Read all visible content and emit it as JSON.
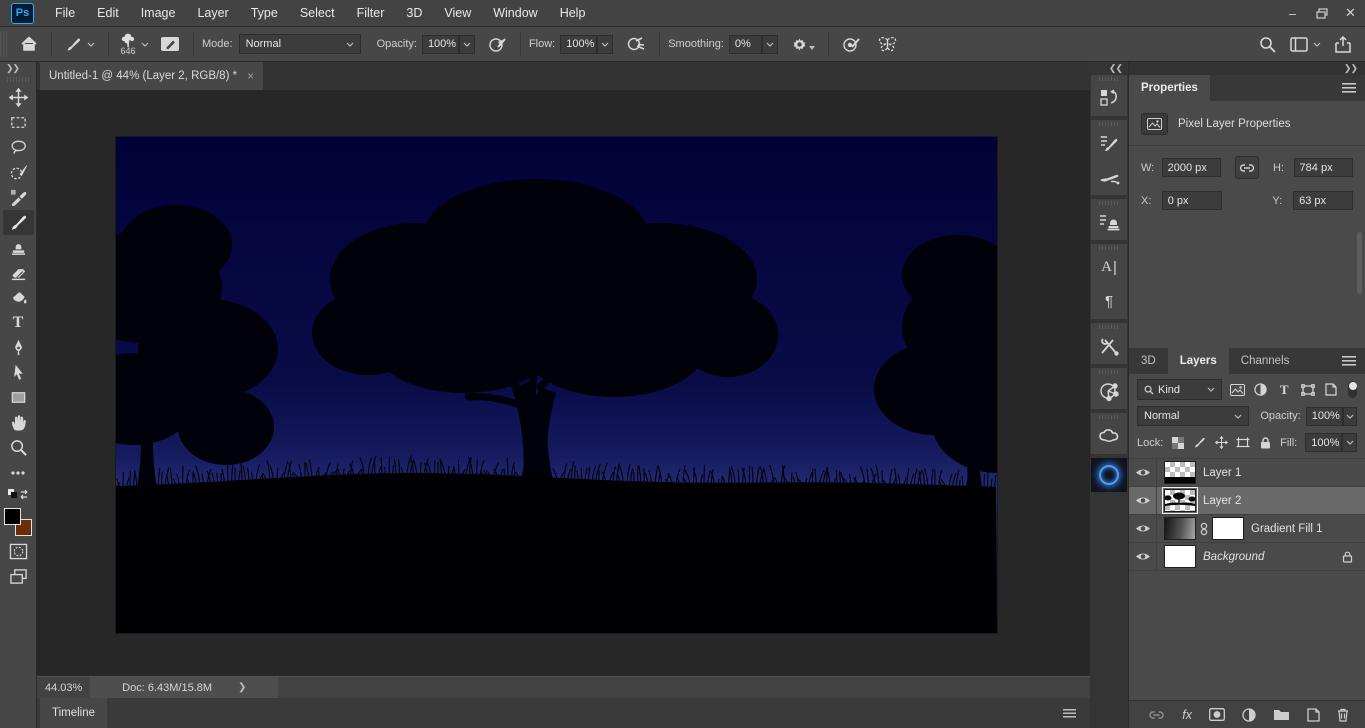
{
  "menu_bar": {
    "logo": "Ps",
    "items": [
      "File",
      "Edit",
      "Image",
      "Layer",
      "Type",
      "Select",
      "Filter",
      "3D",
      "View",
      "Window",
      "Help"
    ]
  },
  "options_bar": {
    "brush_tip_size": "646",
    "mode_label": "Mode:",
    "mode_value": "Normal",
    "opacity_label": "Opacity:",
    "opacity_value": "100%",
    "flow_label": "Flow:",
    "flow_value": "100%",
    "smoothing_label": "Smoothing:",
    "smoothing_value": "0%"
  },
  "document": {
    "tab_title": "Untitled-1 @ 44% (Layer 2, RGB/8) *",
    "close_glyph": "×",
    "zoom_percent": "44.03%",
    "doc_info_label": "Doc:",
    "doc_info": "Doc: 6.43M/15.8M",
    "doc_chevron": "❯"
  },
  "toolbar": {
    "tools": [
      "move",
      "rectangular-marquee",
      "lasso",
      "object-selection",
      "eyedropper",
      "brush",
      "clone-stamp",
      "eraser",
      "paint-bucket",
      "type",
      "pen",
      "path-selection",
      "rectangle",
      "hand",
      "zoom",
      "edit-toolbar"
    ],
    "selected_tool": "brush",
    "foreground_color": "#000000",
    "background_color": "#6b2c08"
  },
  "side_strip_panels": [
    "history",
    "brush-settings",
    "brushes",
    "clone-source",
    "character",
    "paragraph",
    "tool-presets",
    "share",
    "creative-cloud",
    "glow-ring"
  ],
  "properties_panel": {
    "tab": "Properties",
    "header": "Pixel Layer Properties",
    "fields": {
      "w_label": "W:",
      "w_value": "2000 px",
      "h_label": "H:",
      "h_value": "784 px",
      "x_label": "X:",
      "x_value": "0 px",
      "y_label": "Y:",
      "y_value": "63 px"
    }
  },
  "layers_panel": {
    "tabs": [
      "3D",
      "Layers",
      "Channels"
    ],
    "active_tab": "Layers",
    "kind_filter": "Kind",
    "blend_mode": "Normal",
    "opacity_label": "Opacity:",
    "opacity_value": "100%",
    "lock_label": "Lock:",
    "fill_label": "Fill:",
    "fill_value": "100%",
    "layers": [
      {
        "name": "Layer 1",
        "selected": false
      },
      {
        "name": "Layer 2",
        "selected": true
      },
      {
        "name": "Gradient Fill 1",
        "selected": false
      },
      {
        "name": "Background",
        "selected": false,
        "locked": true
      }
    ]
  },
  "timeline": {
    "tab": "Timeline"
  },
  "canvas": {
    "sky_top": "#020238",
    "sky_mid": "#0b0d4c",
    "sky_horizon": "#2a3380",
    "silhouette": "#01010a",
    "pasteboard": "#272727"
  },
  "colors": {
    "accent_blue": "#31a8ff",
    "panel_bg": "#4a4a4a",
    "dark_strip": "#333333",
    "field_bg": "#3c3c3c",
    "selected_row": "#696969"
  }
}
